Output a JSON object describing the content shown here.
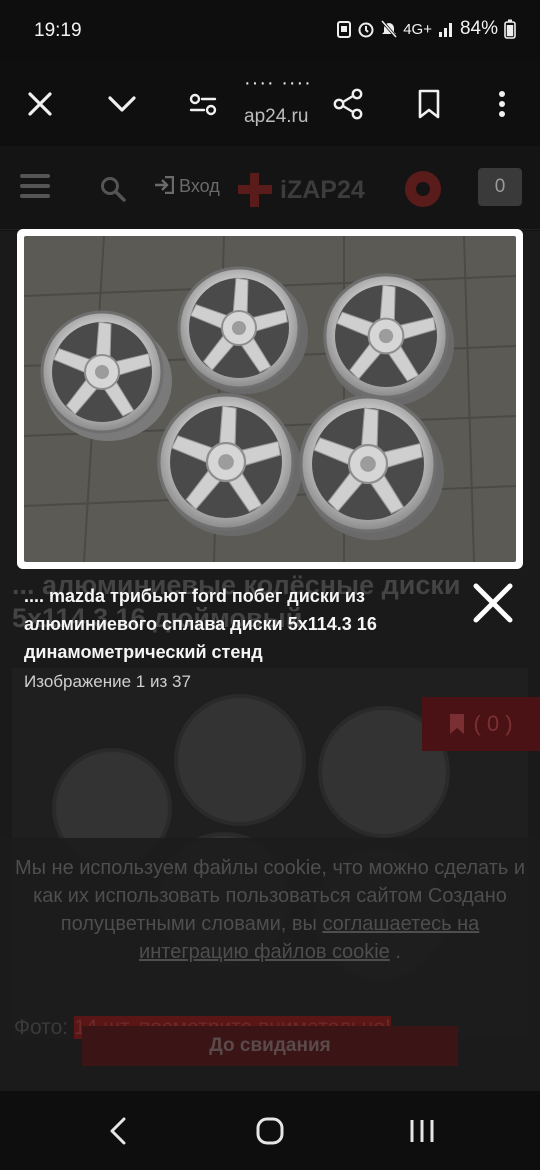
{
  "status_bar": {
    "time": "19:19",
    "network": "4G+",
    "battery": "84%"
  },
  "browser": {
    "url_title": "····  ····",
    "url_domain": "ap24.ru",
    "icons": [
      "close-icon",
      "chevron-down-icon",
      "page-settings-icon",
      "share-icon",
      "bookmark-icon",
      "more-vertical-icon"
    ]
  },
  "site_header": {
    "login_label": "Вход",
    "logo_text": "iZAP24",
    "cart_count": "0"
  },
  "background_page": {
    "title": "... алюминиевые колёсные диски 5x114.3 16 дюймовый",
    "bookmark_count": "( 0 )",
    "note_prefix": "Фото:",
    "note_highlight": "14 шт. посмотрите внимательно!"
  },
  "cookie_banner": {
    "text": "Мы не используем файлы cookie, что можно сделать и как их использовать пользоваться сайтом Создано полуцветными словами, вы ",
    "link_text": "соглашаетесь на интеграцию файлов cookie",
    "text_end": " .",
    "button_label": "До свидания"
  },
  "image_viewer": {
    "caption": ".... mazda трибьют ford побег диски из алюминиевого сплава диски 5x114.3 16 динамометрический стенд",
    "counter": "Изображение 1 из 37"
  },
  "colors": {
    "accent": "#d9342b",
    "background": "#111111",
    "caption": "#f5f5f5"
  }
}
